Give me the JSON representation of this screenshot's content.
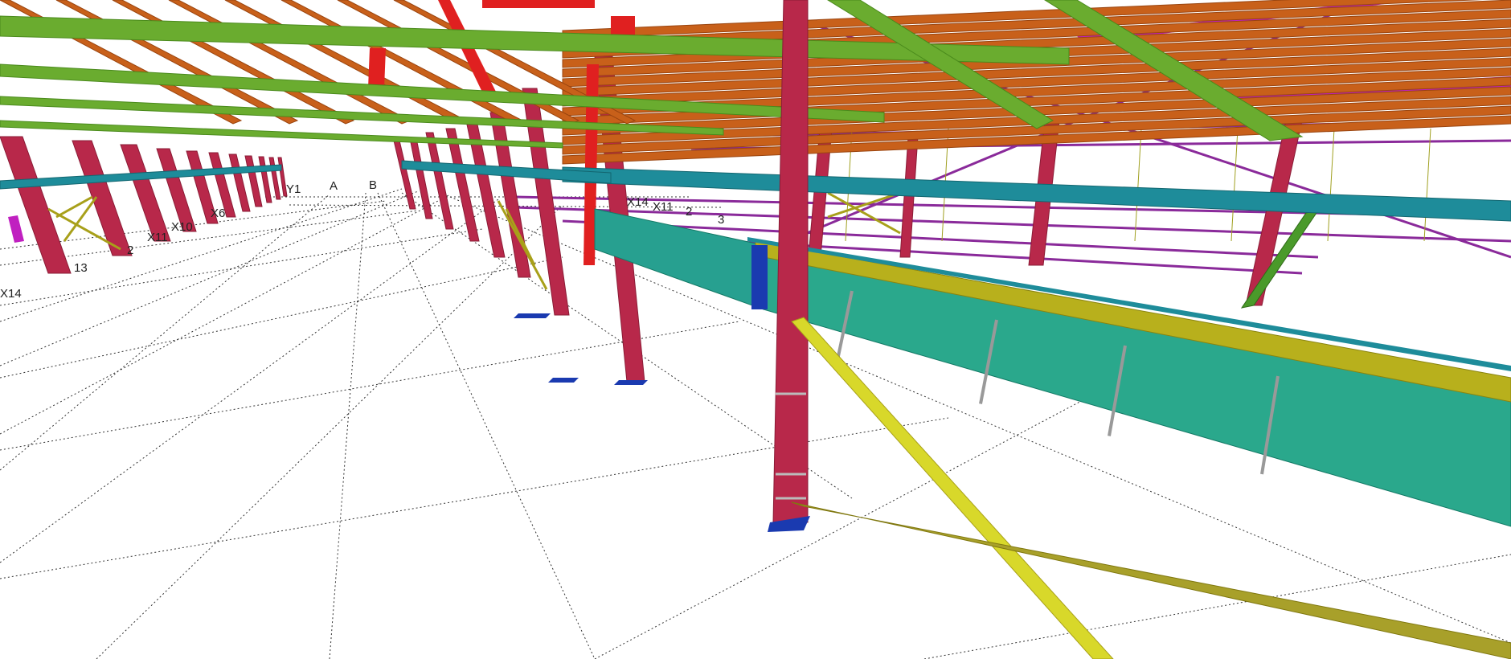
{
  "viewport": {
    "background": "#ffffff",
    "grid_labels": [
      "X14",
      "13",
      "2",
      "X11",
      "X10",
      "X6",
      "Y1",
      "A",
      "B",
      "X14",
      "X11",
      "2",
      "3"
    ]
  },
  "colors": {
    "column": "#b8284a",
    "column_dark": "#8a1c36",
    "rafter": "#6aac2f",
    "rafter_dark": "#4a8a1c",
    "purlin": "#c8601a",
    "purlin_dark": "#9a4510",
    "eave_beam": "#1e8c9a",
    "crane_girder": "#2aa88c",
    "crane_rail": "#b8b01c",
    "bracing": "#d8d82a",
    "bracing_dark": "#a8a01a",
    "wall_girt": "#8a2a9a",
    "magenta_member": "#c020c0",
    "red_member": "#e02020",
    "base_plate": "#1a3ab0"
  }
}
